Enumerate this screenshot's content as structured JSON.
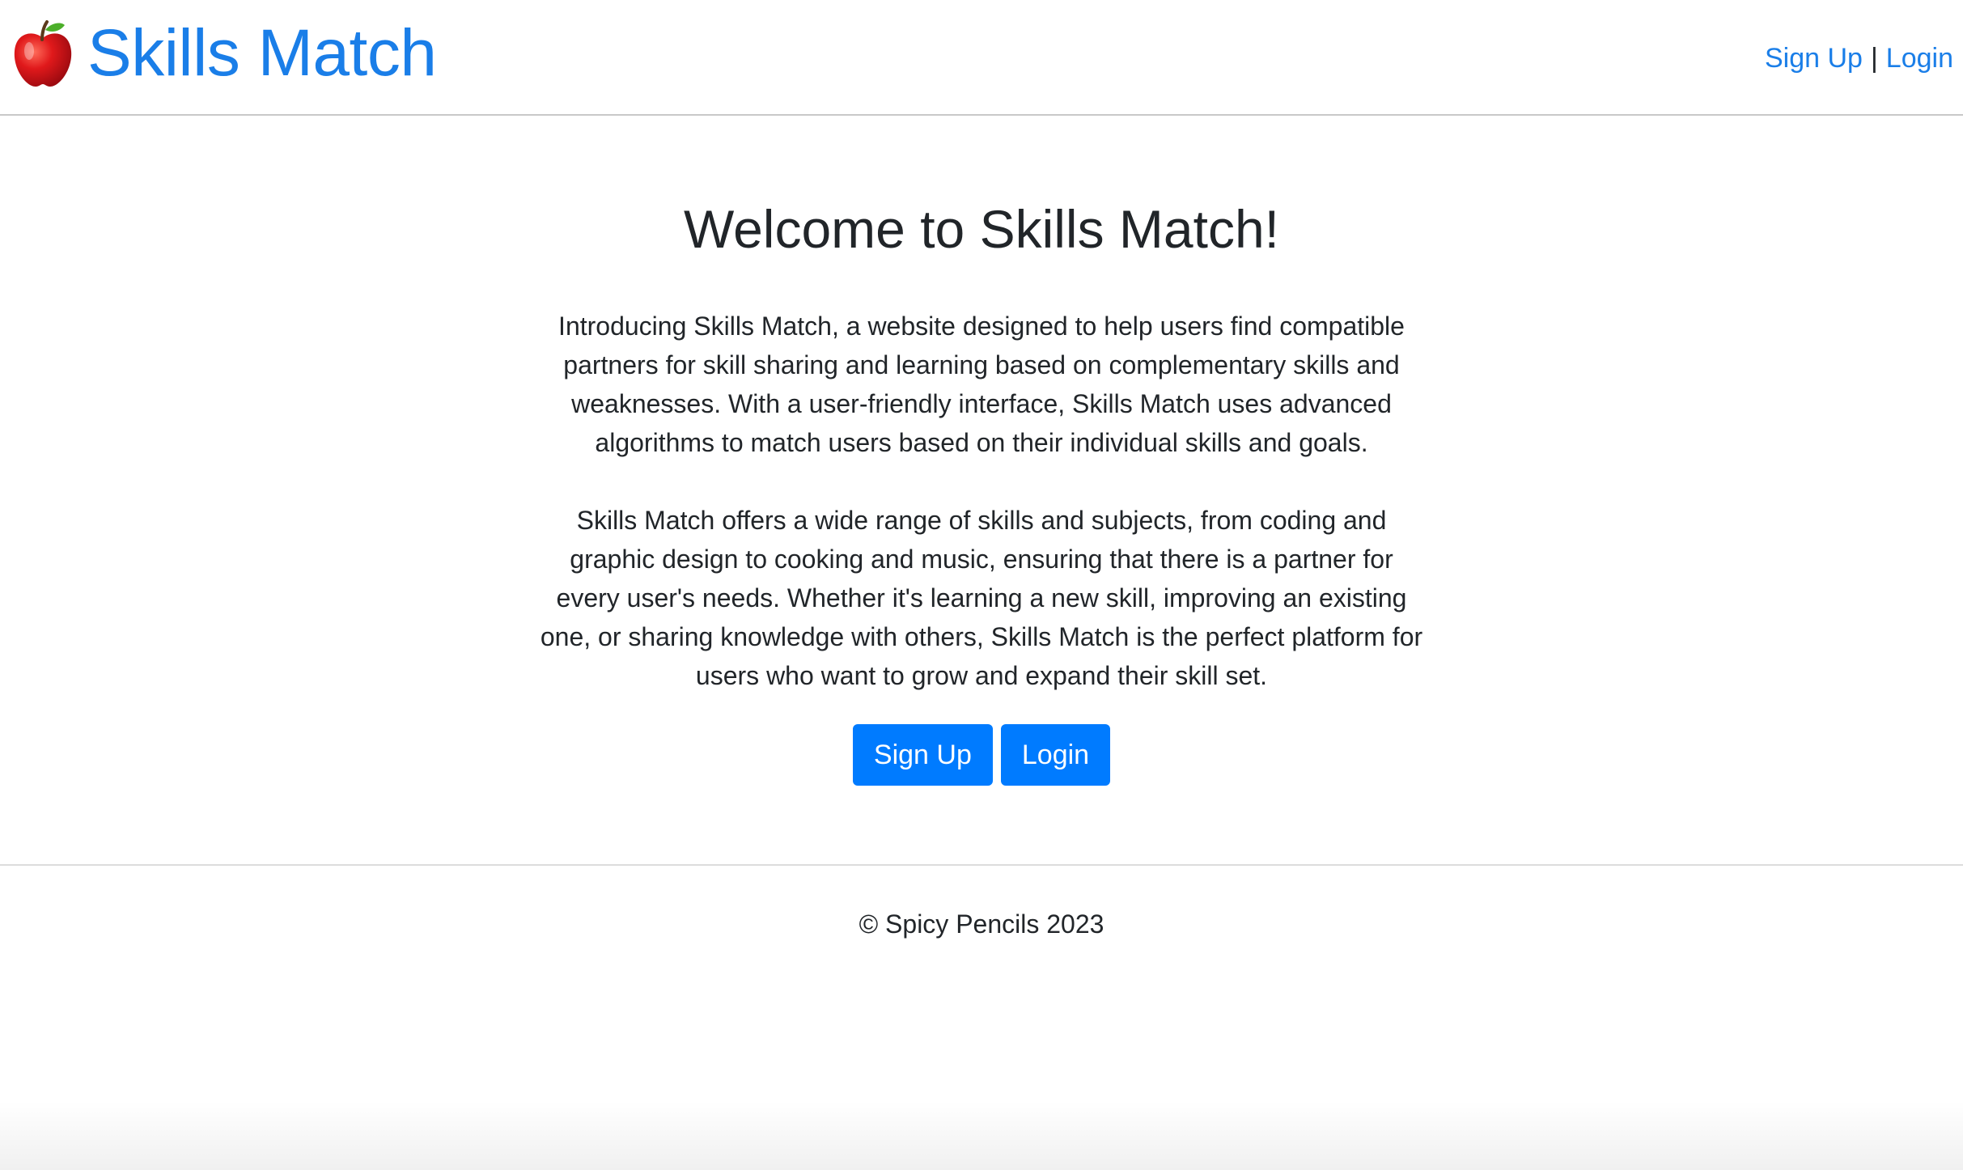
{
  "header": {
    "brand_icon": "apple-icon",
    "brand_label": "Skills Match",
    "nav": {
      "signup_label": "Sign Up",
      "separator": "|",
      "login_label": "Login"
    }
  },
  "main": {
    "title": "Welcome to Skills Match!",
    "paragraphs": [
      "Introducing Skills Match, a website designed to help users find compatible partners for skill sharing and learning based on complementary skills and weaknesses. With a user-friendly interface, Skills Match uses advanced algorithms to match users based on their individual skills and goals.",
      "Skills Match offers a wide range of skills and subjects, from coding and graphic design to cooking and music, ensuring that there is a partner for every user's needs. Whether it's learning a new skill, improving an existing one, or sharing knowledge with others, Skills Match is the perfect platform for users who want to grow and expand their skill set."
    ],
    "buttons": {
      "signup_label": "Sign Up",
      "login_label": "Login"
    }
  },
  "footer": {
    "text": "© Spicy Pencils 2023"
  },
  "colors": {
    "brand": "#1a7ee8",
    "button": "#007bff",
    "text": "#212529"
  }
}
